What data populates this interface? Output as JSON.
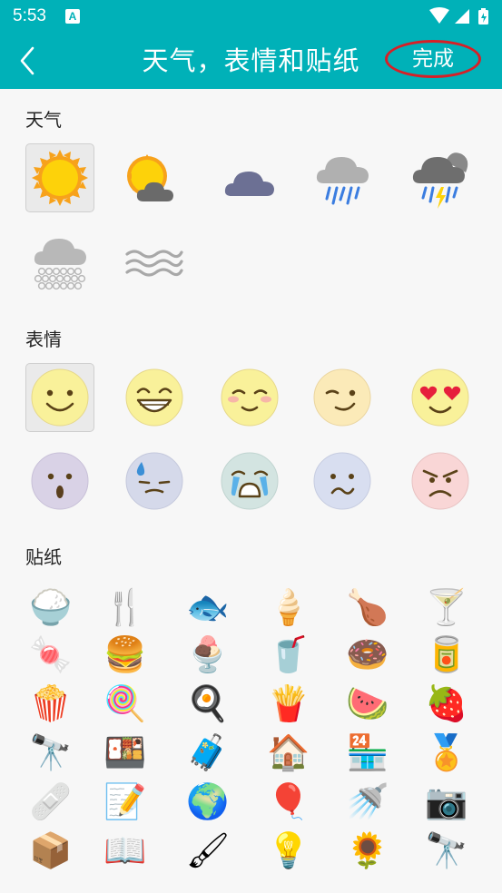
{
  "status_bar": {
    "time": "5:53",
    "notification_letter": "A"
  },
  "header": {
    "title": "天气，表情和贴纸",
    "done_label": "完成"
  },
  "sections": {
    "weather": "天气",
    "emoji": "表情",
    "stickers": "贴纸"
  },
  "weather_icons": [
    "sun-icon",
    "partly-cloudy-icon",
    "cloudy-icon",
    "rain-icon",
    "thunderstorm-icon",
    "snow-icon",
    "fog-icon"
  ],
  "emoji_icons": [
    "smile-emoji",
    "grin-emoji",
    "blush-emoji",
    "wink-emoji",
    "heart-eyes-emoji",
    "surprised-emoji",
    "sweat-emoji",
    "crying-emoji",
    "confused-emoji",
    "angry-emoji"
  ],
  "emoji_colors": [
    "#f9f19a",
    "#f9f19a",
    "#f9f19a",
    "#fbeab8",
    "#f9f19a",
    "#d9d2e6",
    "#d5d9ea",
    "#d3e4e1",
    "#d8def0",
    "#f9d6d6"
  ],
  "stickers": [
    {
      "name": "rice-bowl-sticker",
      "glyph": "🍚"
    },
    {
      "name": "cutlery-sticker",
      "glyph": "🍴"
    },
    {
      "name": "grilled-fish-sticker",
      "glyph": "🐟"
    },
    {
      "name": "ice-cream-cone-sticker",
      "glyph": "🍦"
    },
    {
      "name": "roast-chicken-sticker",
      "glyph": "🍗"
    },
    {
      "name": "cocktail-sticker",
      "glyph": "🍸"
    },
    {
      "name": "candy-sticker",
      "glyph": "🍬"
    },
    {
      "name": "burger-sticker",
      "glyph": "🍔"
    },
    {
      "name": "sundae-sticker",
      "glyph": "🍨"
    },
    {
      "name": "bubble-tea-sticker",
      "glyph": "🥤"
    },
    {
      "name": "donut-sticker",
      "glyph": "🍩"
    },
    {
      "name": "ketchup-sticker",
      "glyph": "🥫"
    },
    {
      "name": "popcorn-sticker",
      "glyph": "🍿"
    },
    {
      "name": "cotton-candy-sticker",
      "glyph": "🍭"
    },
    {
      "name": "breakfast-plate-sticker",
      "glyph": "🍳"
    },
    {
      "name": "fries-sticker",
      "glyph": "🍟"
    },
    {
      "name": "watermelon-sticker",
      "glyph": "🍉"
    },
    {
      "name": "strawberry-sticker",
      "glyph": "🍓"
    },
    {
      "name": "binoculars-sticker",
      "glyph": "🔭"
    },
    {
      "name": "sushi-box-sticker",
      "glyph": "🍱"
    },
    {
      "name": "suitcase-sticker",
      "glyph": "🧳"
    },
    {
      "name": "house-sticker",
      "glyph": "🏠"
    },
    {
      "name": "restaurant-sticker",
      "glyph": "🏪"
    },
    {
      "name": "medal-sticker",
      "glyph": "🏅"
    },
    {
      "name": "bandage-sticker",
      "glyph": "🩹"
    },
    {
      "name": "notes-sticker",
      "glyph": "📝"
    },
    {
      "name": "globe-sticker",
      "glyph": "🌍"
    },
    {
      "name": "open-sign-sticker",
      "glyph": "🎈"
    },
    {
      "name": "watering-can-sticker",
      "glyph": "🚿"
    },
    {
      "name": "camera-tripod-sticker",
      "glyph": "📷"
    },
    {
      "name": "gift-box-sticker",
      "glyph": "📦"
    },
    {
      "name": "open-book-sticker",
      "glyph": "📖"
    },
    {
      "name": "painting-sticker",
      "glyph": "🖌"
    },
    {
      "name": "lamp-box-sticker",
      "glyph": "💡"
    },
    {
      "name": "sunflower-sticker",
      "glyph": "🌻"
    },
    {
      "name": "telescope-sticker",
      "glyph": "🔭"
    }
  ]
}
